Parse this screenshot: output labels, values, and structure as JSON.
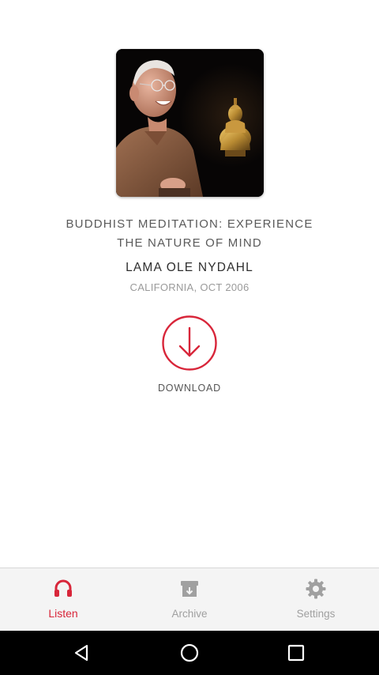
{
  "talk": {
    "title_line1": "BUDDHIST MEDITATION: EXPERIENCE",
    "title_line2": "THE NATURE OF MIND",
    "speaker": "LAMA OLE NYDAHL",
    "location_date": "CALIFORNIA, OCT 2006",
    "cover_image": "portrait-with-buddha-statue"
  },
  "download": {
    "label": "DOWNLOAD",
    "icon": "download-arrow-circle-icon"
  },
  "tabs": [
    {
      "label": "Listen",
      "icon": "headphones-icon",
      "active": true
    },
    {
      "label": "Archive",
      "icon": "archive-box-icon",
      "active": false
    },
    {
      "label": "Settings",
      "icon": "gear-icon",
      "active": false
    }
  ],
  "system_nav": {
    "back": "back-icon",
    "home": "home-icon",
    "recents": "recents-icon"
  },
  "colors": {
    "accent": "#d8263a",
    "inactive": "#a0a0a0",
    "tabbar_bg": "#f4f4f4",
    "navbar_bg": "#000000"
  }
}
